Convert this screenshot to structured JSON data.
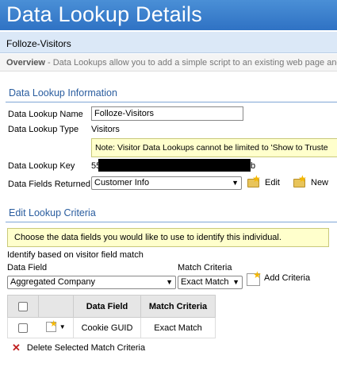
{
  "header": {
    "title": "Data Lookup Details"
  },
  "subbar": {
    "name": "Folloze-Visitors"
  },
  "overview": {
    "label": "Overview",
    "text": "- Data Lookups allow you to add a simple script to an existing web page and h"
  },
  "info": {
    "heading": "Data Lookup Information",
    "name_label": "Data Lookup Name",
    "name_value": "Folloze-Visitors",
    "type_label": "Data Lookup Type",
    "type_value": "Visitors",
    "note": "Note: Visitor Data Lookups cannot be limited to 'Show to Truste",
    "key_label": "Data Lookup Key",
    "key_prefix": "55",
    "key_suffix": "b",
    "fields_label": "Data Fields Returned",
    "fields_selected": "Customer Info",
    "edit_label": "Edit",
    "new_label": "New"
  },
  "criteria": {
    "heading": "Edit Lookup Criteria",
    "hint": "Choose the data fields you would like to use to identify this individual.",
    "identify_label": "Identify based on visitor field match",
    "data_field_label": "Data Field",
    "data_field_selected": "Aggregated Company",
    "match_label": "Match Criteria",
    "match_selected": "Exact Match",
    "add_label": "Add Criteria",
    "table": {
      "headers": [
        "Data Field",
        "Match Criteria"
      ],
      "rows": [
        {
          "field": "Cookie GUID",
          "match": "Exact Match"
        }
      ]
    },
    "delete_label": "Delete Selected Match Criteria"
  }
}
